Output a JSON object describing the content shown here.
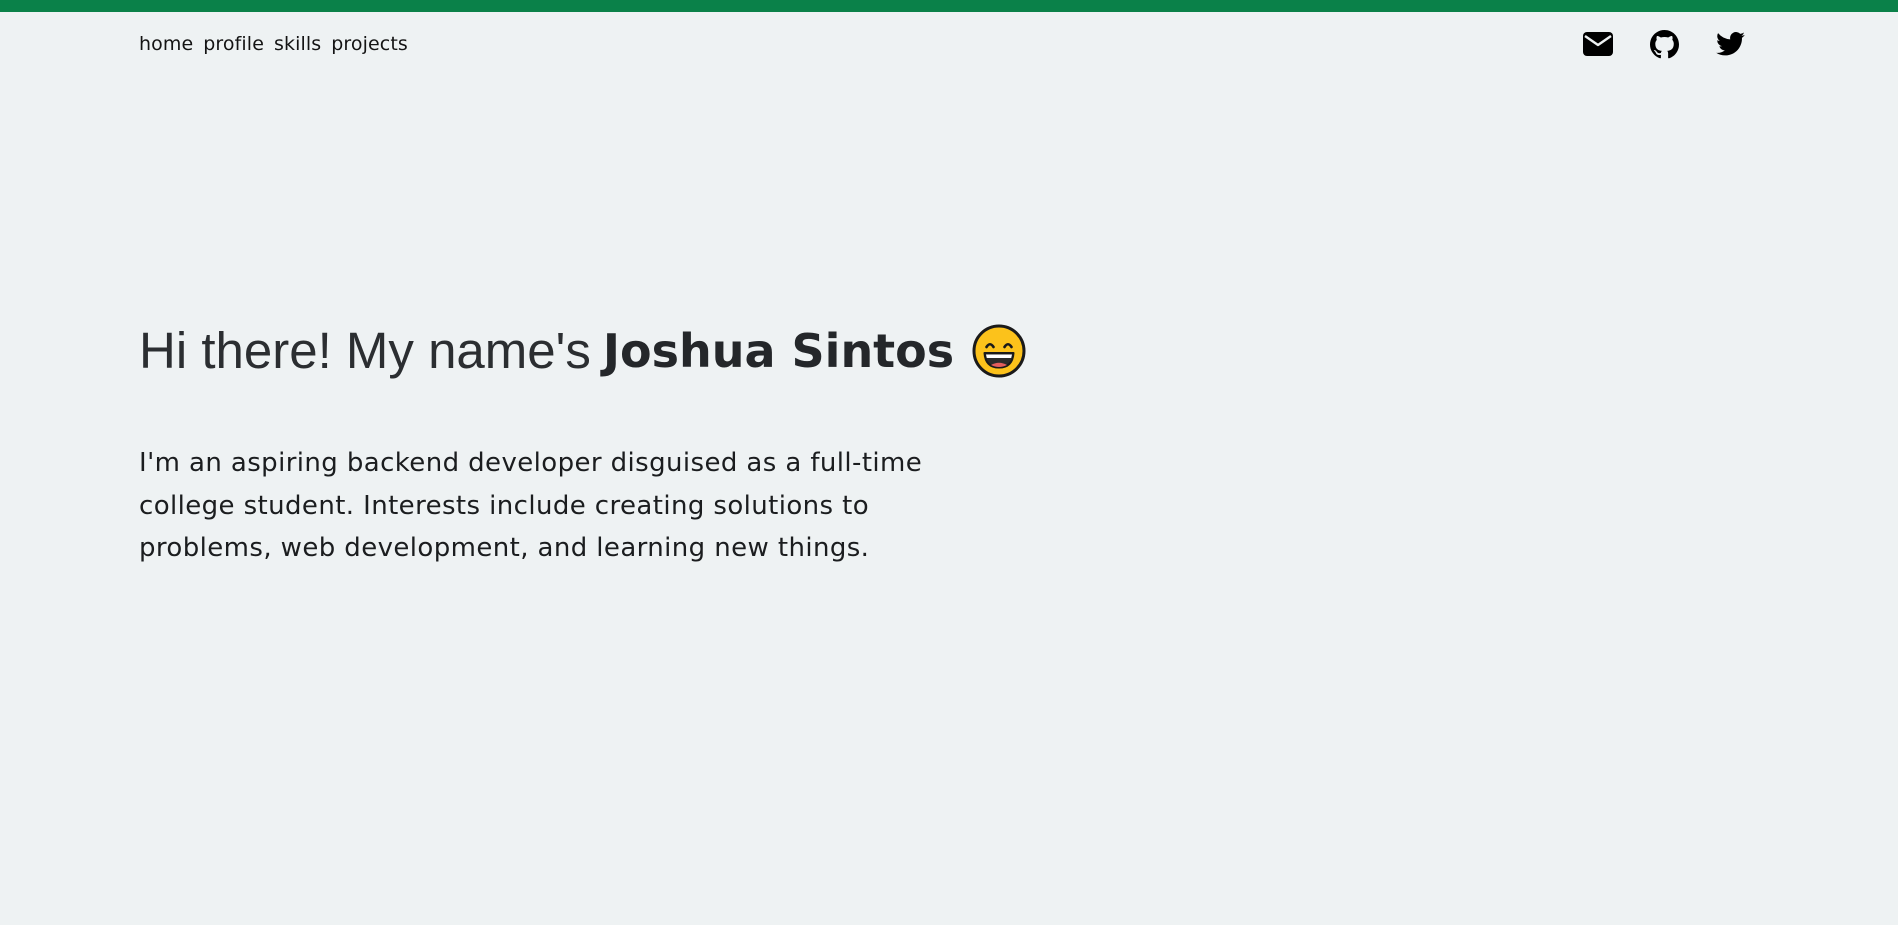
{
  "nav": {
    "links": [
      "home",
      "profile",
      "skills",
      "projects"
    ]
  },
  "social": {
    "icons": [
      "envelope-icon",
      "github-icon",
      "twitter-icon"
    ]
  },
  "hero": {
    "greeting": "Hi there! My name's",
    "name": "Joshua Sintos",
    "emoji": "grinning-face-icon",
    "description": "I'm an aspiring backend developer disguised as a full-time college student. Interests include creating solutions to problems, web development, and learning new things."
  },
  "colors": {
    "accent": "#0a8149",
    "background": "#eef2f3",
    "text": "#24272a",
    "emoji_face": "#fcc21b"
  }
}
